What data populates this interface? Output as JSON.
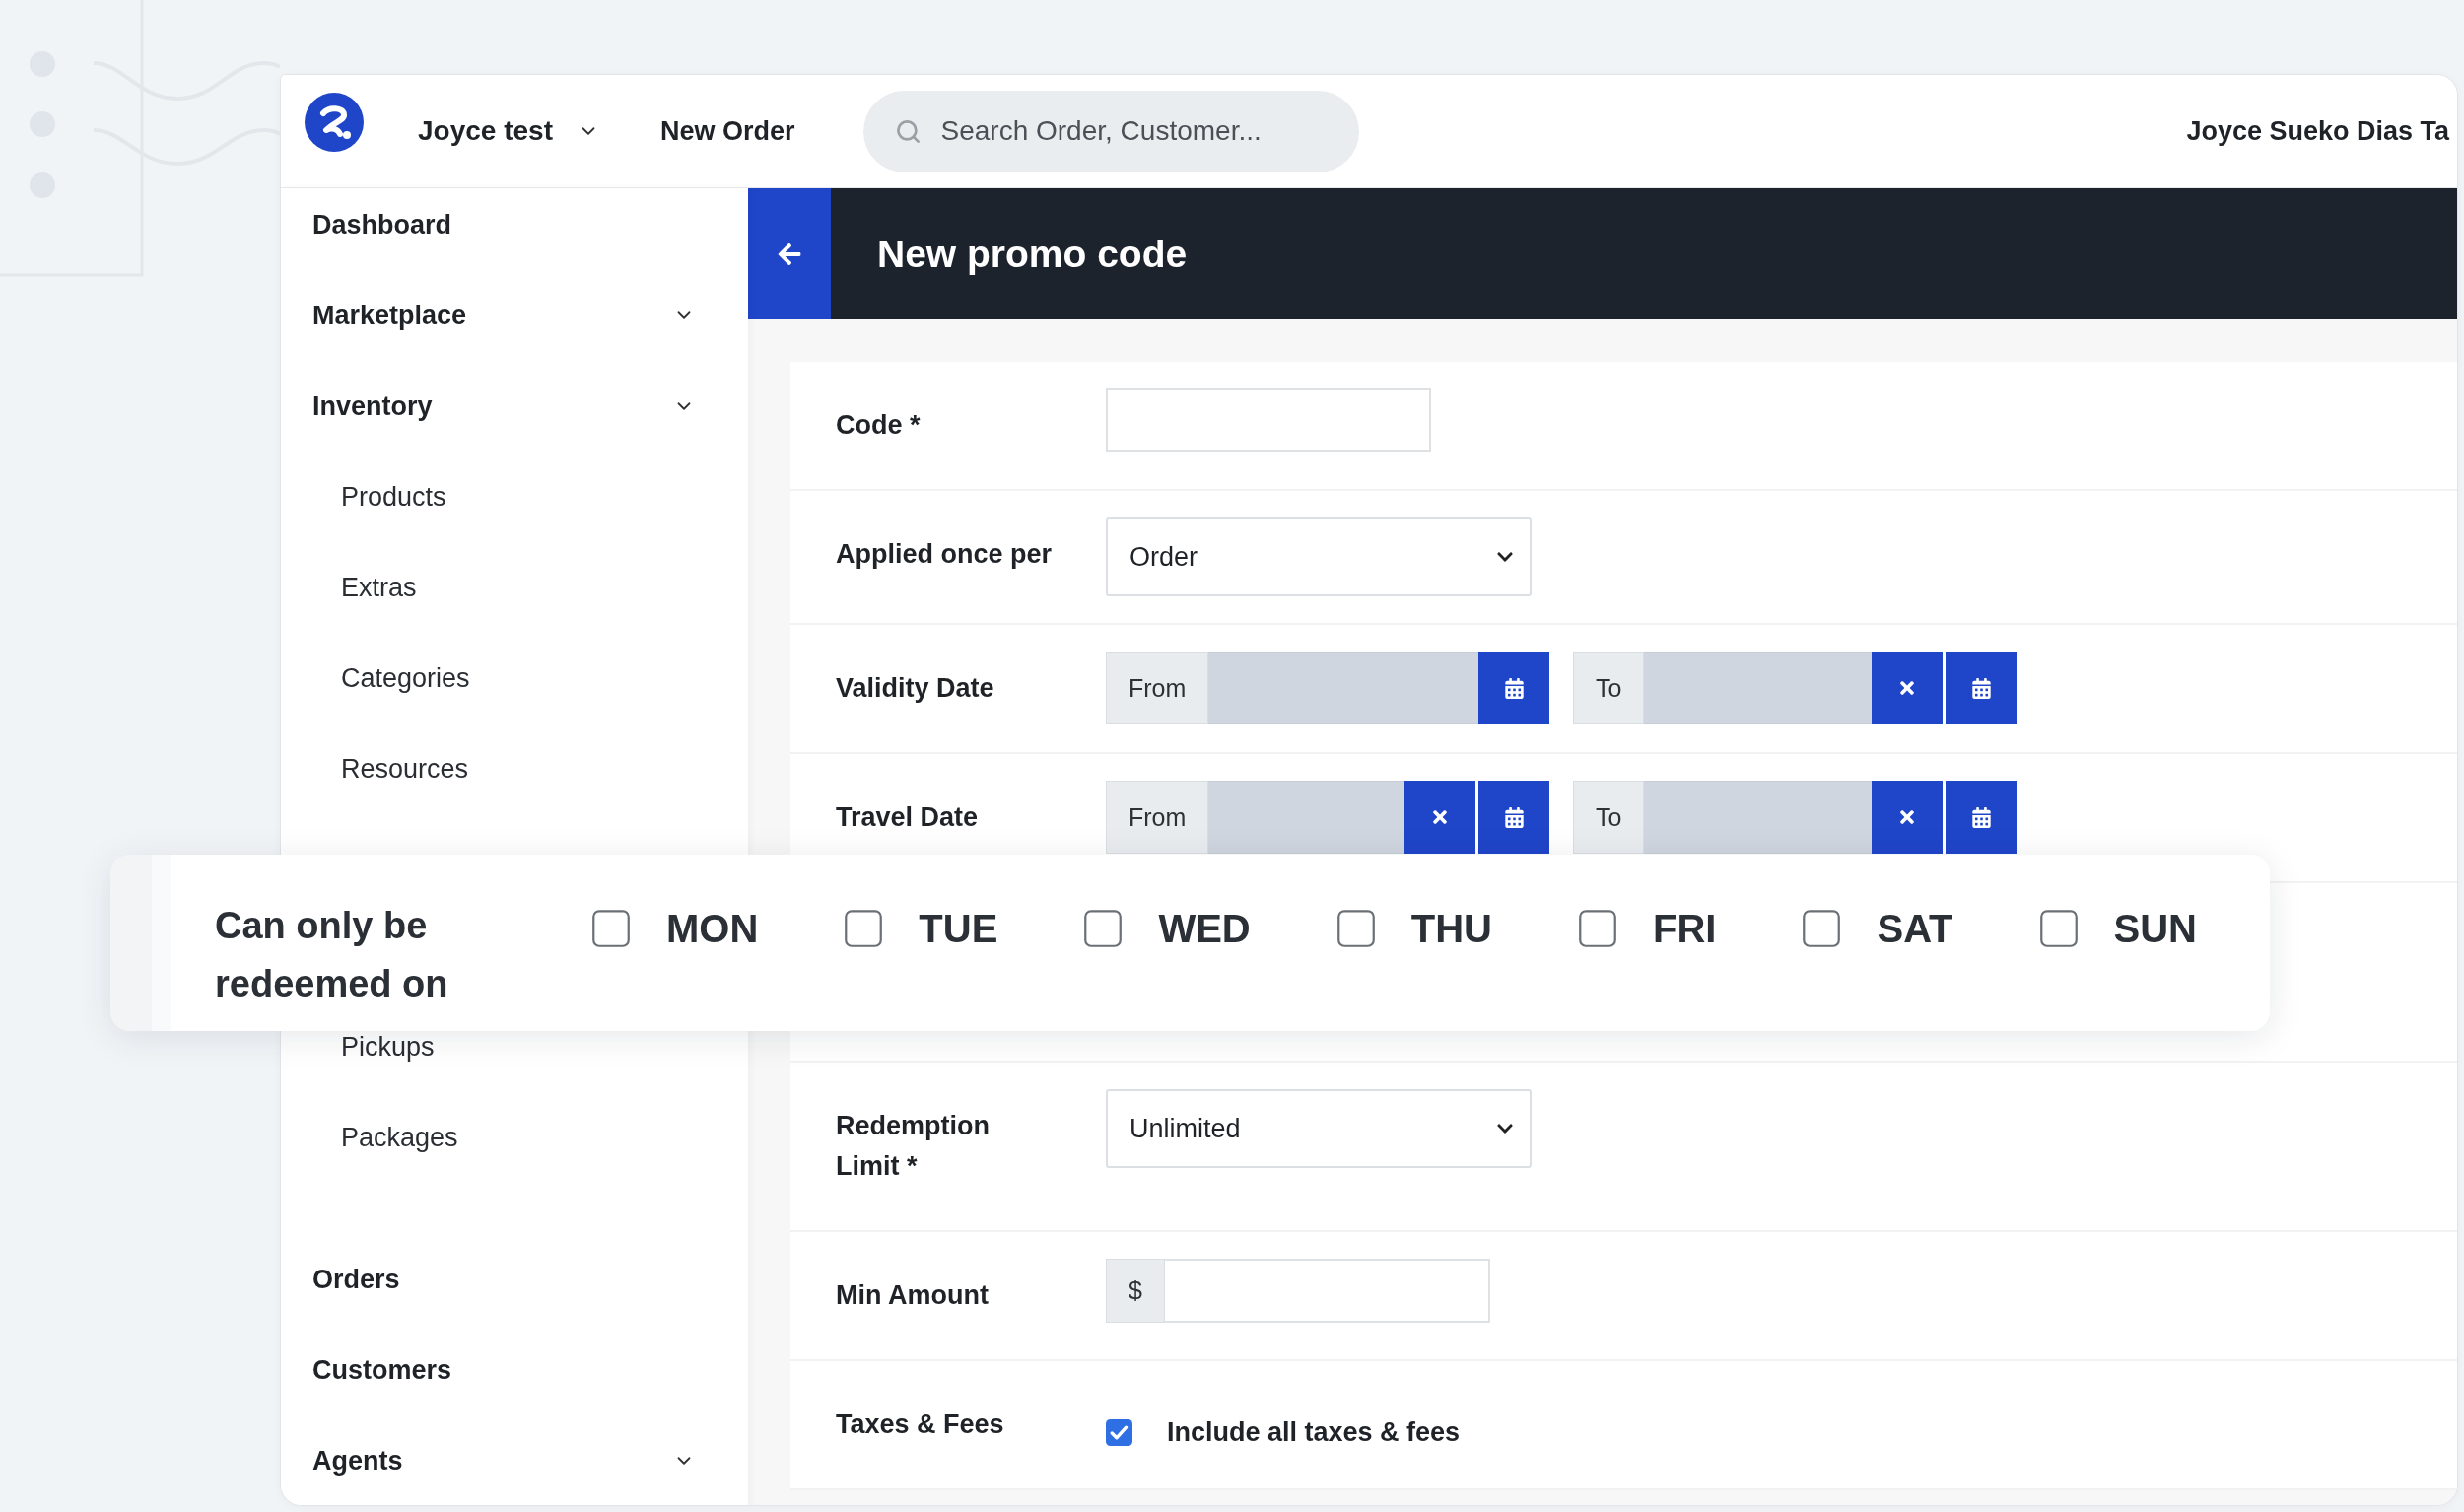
{
  "header": {
    "workspace": "Joyce test",
    "new_order": "New Order",
    "search": {
      "placeholder": "Search Order, Customer..."
    },
    "user_name": "Joyce Sueko Dias Ta"
  },
  "sidebar": {
    "items": [
      {
        "label": "Dashboard",
        "has_submenu": false
      },
      {
        "label": "Marketplace",
        "has_submenu": true
      },
      {
        "label": "Inventory",
        "has_submenu": true,
        "children": [
          {
            "label": "Products"
          },
          {
            "label": "Extras"
          },
          {
            "label": "Categories"
          },
          {
            "label": "Resources"
          },
          {
            "label": "Pickups"
          },
          {
            "label": "Packages"
          }
        ]
      },
      {
        "label": "Orders",
        "has_submenu": false
      },
      {
        "label": "Customers",
        "has_submenu": false
      },
      {
        "label": "Agents",
        "has_submenu": true
      }
    ]
  },
  "page": {
    "title": "New promo code"
  },
  "form": {
    "rows": [
      {
        "kind": "text",
        "label": "Code *"
      },
      {
        "kind": "select",
        "label": "Applied once per",
        "value": "Order"
      },
      {
        "kind": "date_range",
        "label": "Validity Date",
        "from": {
          "prefix": "From",
          "clearable": false
        },
        "to": {
          "prefix": "To",
          "clearable": true
        }
      },
      {
        "kind": "date_range",
        "label": "Travel Date",
        "from": {
          "prefix": "From",
          "clearable": true
        },
        "to": {
          "prefix": "To",
          "clearable": true
        }
      },
      {
        "kind": "select",
        "label": "Redemption Limit *",
        "value": "Unlimited"
      },
      {
        "kind": "money",
        "label": "Min Amount",
        "prefix": "$"
      },
      {
        "kind": "checkbox",
        "label": "Taxes & Fees",
        "option": "Include all taxes & fees",
        "checked": true
      }
    ]
  },
  "redeem_days": {
    "label": "Can only be redeemed on",
    "days": [
      {
        "label": "MON",
        "checked": false
      },
      {
        "label": "TUE",
        "checked": false
      },
      {
        "label": "WED",
        "checked": false
      },
      {
        "label": "THU",
        "checked": false
      },
      {
        "label": "FRI",
        "checked": false
      },
      {
        "label": "SAT",
        "checked": false
      },
      {
        "label": "SUN",
        "checked": false
      }
    ]
  }
}
